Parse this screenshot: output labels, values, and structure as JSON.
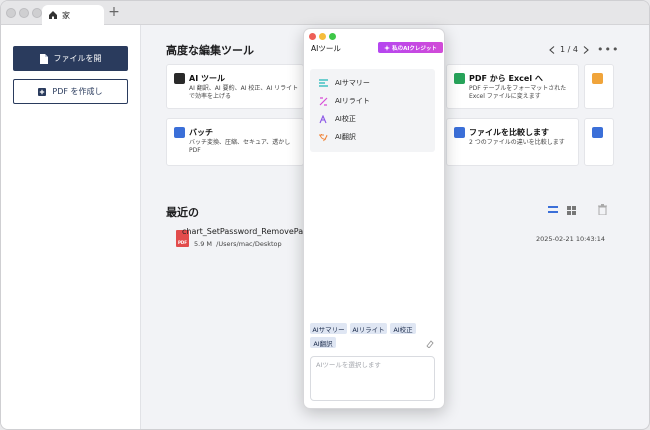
{
  "tab": {
    "label": "家"
  },
  "sidebar": {
    "open_file_label": "ファイルを開",
    "create_pdf_label": "PDF を作成し"
  },
  "tools": {
    "section_title": "高度な編集ツール",
    "pager": "1 / 4",
    "cards": [
      {
        "title": "AI ツール",
        "desc": "AI 翻訳、AI 要約、AI 校正、AI リライトで効率を上げる"
      },
      {
        "title": "PDF から Excel へ",
        "desc": "PDF テーブルをフォーマットされた Excel ファイルに変えます"
      },
      {
        "title": "バッチ",
        "desc": "バッチ変換、圧縮、セキュア、透かし PDF"
      },
      {
        "title": "ファイルを比較します",
        "desc": "2 つのファイルの違いを比較します"
      }
    ]
  },
  "recent": {
    "section_title": "最近の",
    "files": [
      {
        "icon_text": "PDF",
        "name": "chart_SetPassword_RemovePas",
        "size": "5.9 M",
        "path": "/Users/mac/Desktop",
        "date": "2025-02-21 10:43:14"
      }
    ]
  },
  "ai_popup": {
    "title": "AIツール",
    "credit_label": "私のAIクレジット",
    "menu": [
      {
        "label": "AIサマリー",
        "icon": "summary-icon"
      },
      {
        "label": "AIリライト",
        "icon": "rewrite-icon"
      },
      {
        "label": "AI校正",
        "icon": "proofread-icon"
      },
      {
        "label": "AI翻訳",
        "icon": "translate-icon"
      }
    ],
    "chips": [
      "AIサマリー",
      "AIリライト",
      "AI校正",
      "AI翻訳"
    ],
    "placeholder": "AIツールを選択します"
  },
  "colors": {
    "primary": "#2a3b5d",
    "accent_purple": "#c04ae6",
    "pdf_red": "#e24b4b",
    "excel_green": "#27a35a",
    "batch_blue": "#3b6fd8"
  }
}
